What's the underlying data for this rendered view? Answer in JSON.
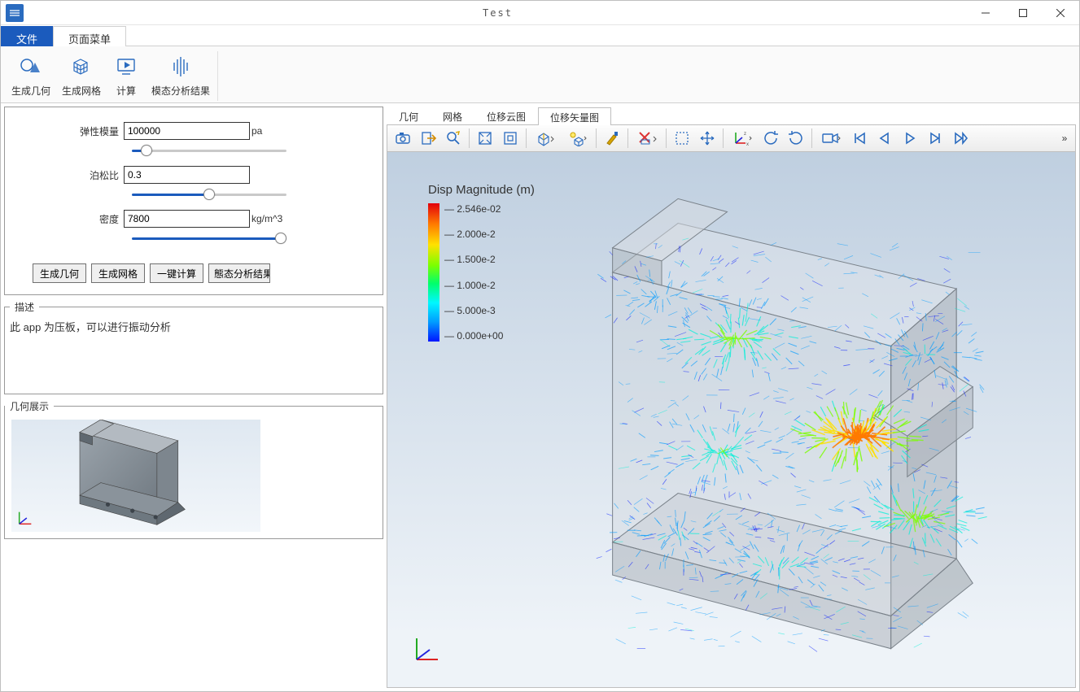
{
  "window": {
    "title": "Test"
  },
  "ribbon": {
    "tabs": {
      "file": "文件",
      "page": "页面菜单"
    },
    "buttons": {
      "gen_geom": "生成几何",
      "gen_mesh": "生成网格",
      "compute": "计算",
      "modal_results": "模态分析结果"
    }
  },
  "form": {
    "elastic_label": "弹性模量",
    "elastic_value": "100000",
    "elastic_unit": "pa",
    "poisson_label": "泊松比",
    "poisson_value": "0.3",
    "density_label": "密度",
    "density_value": "7800",
    "density_unit": "kg/m^3"
  },
  "actions": {
    "gen_geom": "生成几何",
    "gen_mesh": "生成网格",
    "one_click": "一键计算",
    "modal_results": "態态分析结果"
  },
  "description": {
    "legend": "描述",
    "text": "此 app 为压板，可以进行振动分析"
  },
  "geom_legend": "几何展示",
  "viewer_tabs": {
    "geometry": "几何",
    "mesh": "网格",
    "disp_cloud": "位移云图",
    "disp_vector": "位移矢量图"
  },
  "chart_data": {
    "type": "colorbar",
    "title": "Disp Magnitude (m)",
    "ticks": [
      "2.546e-02",
      "2.000e-2",
      "1.500e-2",
      "1.000e-2",
      "5.000e-3",
      "0.000e+00"
    ],
    "range": [
      0.0,
      0.02546
    ],
    "colormap": "jet"
  },
  "icons": {
    "camera": "camera-icon",
    "export": "export-icon",
    "zoom_fit": "zoom-fit-icon",
    "zoom_box": "zoom-box-icon",
    "zoom_reset": "zoom-reset-icon",
    "view_cube": "view-cube-icon",
    "light": "light-icon",
    "brush": "brush-icon",
    "axis_toggle": "axis-toggle-icon",
    "select": "select-box-icon",
    "pan": "pan-icon",
    "axes_xyz": "axes-xyz-icon",
    "rotate_ccw": "rotate-ccw-icon",
    "rotate_cw": "rotate-cw-icon",
    "camera2": "video-icon",
    "first": "first-frame-icon",
    "prev": "prev-frame-icon",
    "play": "play-icon",
    "next": "next-frame-icon",
    "last": "last-frame-icon",
    "more": "more-icon"
  }
}
